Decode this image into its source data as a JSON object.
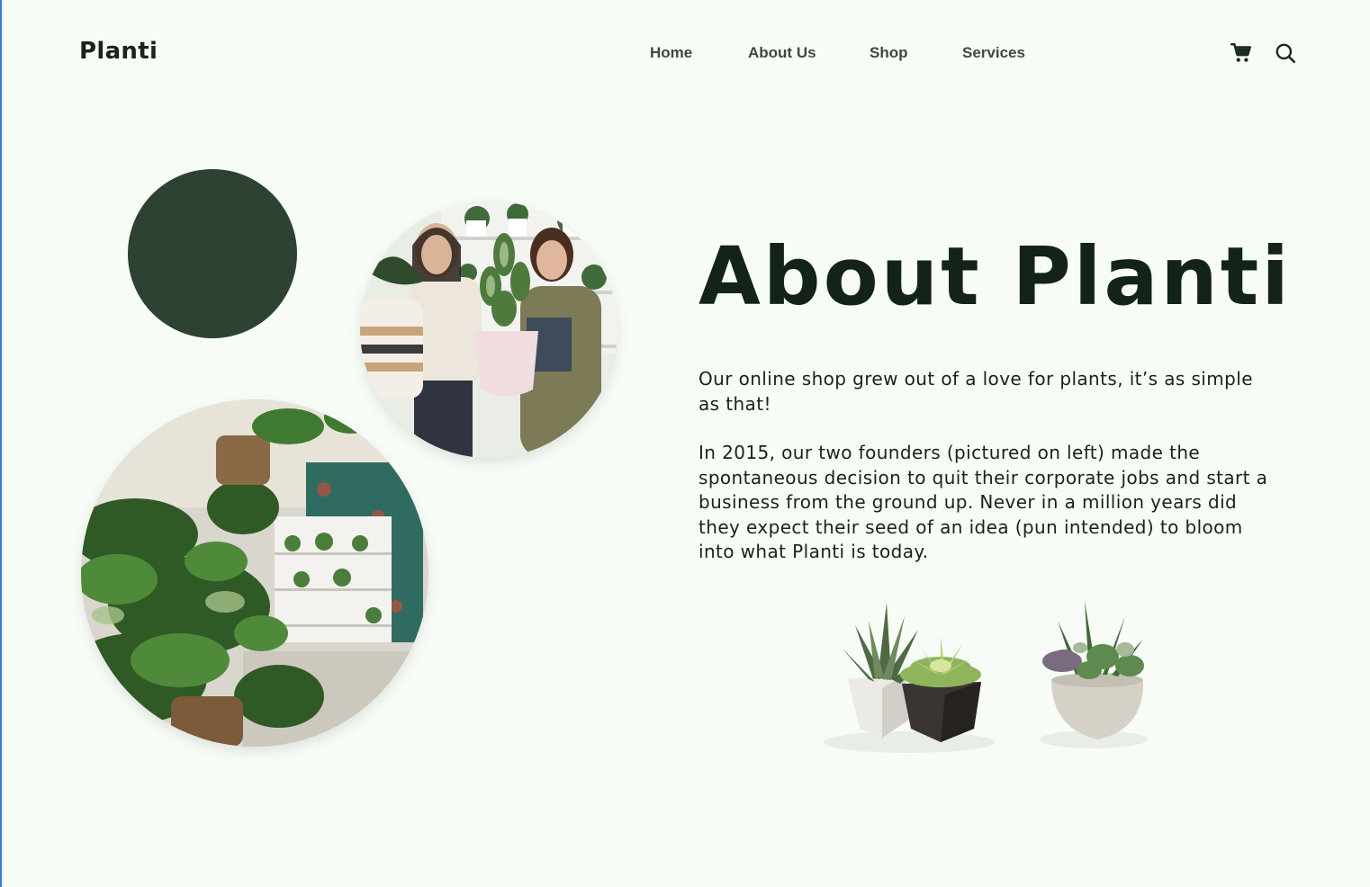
{
  "brand": {
    "logo_text": "Planti"
  },
  "nav": {
    "items": [
      {
        "label": "Home"
      },
      {
        "label": "About Us"
      },
      {
        "label": "Shop"
      },
      {
        "label": "Services"
      }
    ],
    "icons": {
      "cart": "cart-icon",
      "search": "search-icon"
    }
  },
  "about": {
    "title": "About Planti",
    "paragraphs": [
      "Our online shop grew out of a love for plants, it’s as simple as that!",
      "In 2015, our two founders (pictured on left) made the spontaneous decision to quit their corporate jobs and start a business from the ground up. Never in a million years did they expect their seed of an idea (pun intended) to bloom into what Planti is today."
    ]
  },
  "colors": {
    "background": "#f7fcf6",
    "accent_dark_green": "#2d4233",
    "text": "#16241a"
  }
}
